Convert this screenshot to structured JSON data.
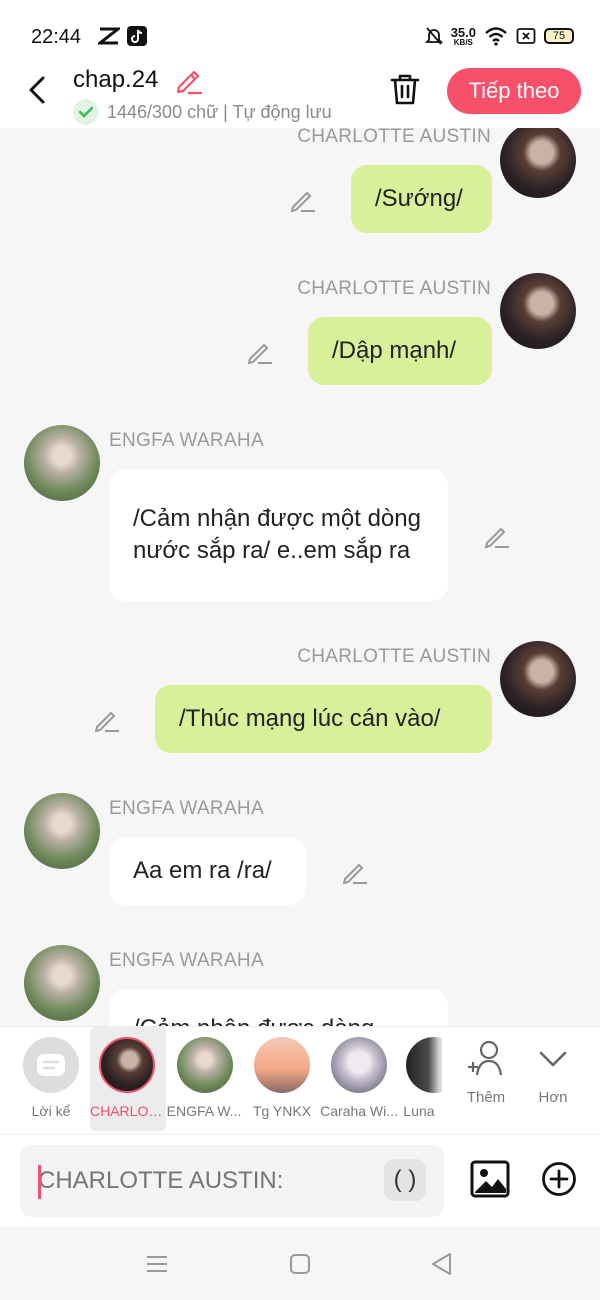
{
  "status_bar": {
    "time": "22:44",
    "speed_value": "35.0",
    "speed_unit": "KB/S",
    "battery": "75"
  },
  "header": {
    "title": "chap.24",
    "autosave": "1446/300 chữ | Tự động lưu",
    "next_label": "Tiếp theo"
  },
  "messages": [
    {
      "side": "right",
      "speaker": "CHARLOTTE AUSTIN",
      "text": "/Sướng/"
    },
    {
      "side": "right",
      "speaker": "CHARLOTTE AUSTIN",
      "text": "/Dập mạnh/"
    },
    {
      "side": "left",
      "speaker": "ENGFA WARAHA",
      "text": "/Cảm nhận được một dòng nước sắp ra/ e..em sắp ra"
    },
    {
      "side": "right",
      "speaker": "CHARLOTTE AUSTIN",
      "text": "/Thúc mạng lúc cán vào/"
    },
    {
      "side": "left",
      "speaker": "ENGFA WARAHA",
      "text": "Aa em ra /ra/"
    },
    {
      "side": "left",
      "speaker": "ENGFA WARAHA",
      "text": "/Cảm nhận được dòng"
    }
  ],
  "characters": [
    {
      "label": "Lời kể"
    },
    {
      "label": "CHARLOT..."
    },
    {
      "label": "ENGFA W..."
    },
    {
      "label": "Tg YNKX"
    },
    {
      "label": "Caraha Wi..."
    },
    {
      "label": "Luna"
    }
  ],
  "actions": {
    "add_label": "Thêm",
    "more_label": "Hơn"
  },
  "composer": {
    "placeholder": "CHARLOTTE AUSTIN:",
    "paren": "( )"
  },
  "colors": {
    "accent": "#f7506b",
    "bubble_right": "#d8f09a",
    "bubble_left": "#ffffff",
    "background": "#f6f6f6"
  }
}
